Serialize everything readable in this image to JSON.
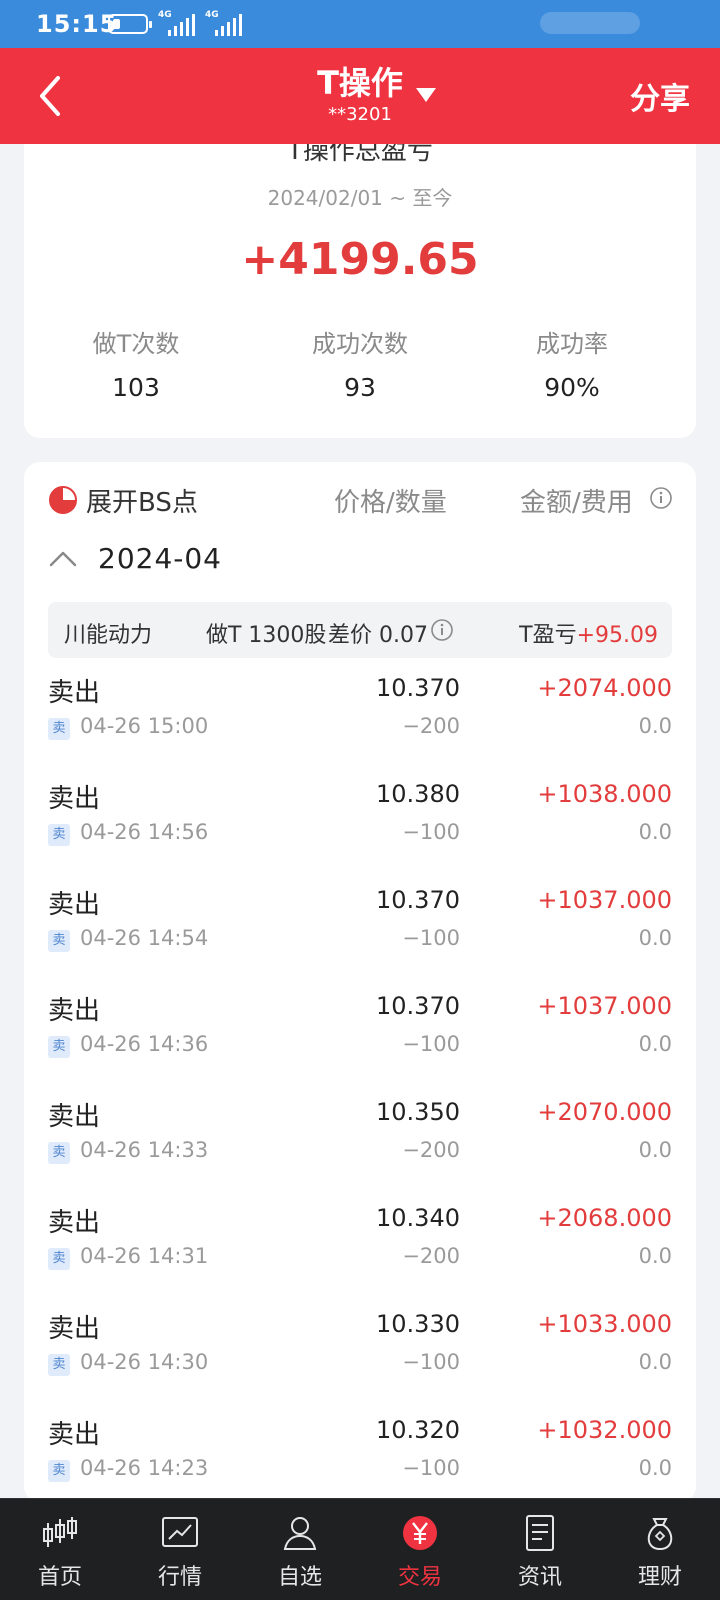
{
  "status_bar": {
    "time": "15:15",
    "network_1": "4G",
    "network_2": "4G"
  },
  "header": {
    "title": "T操作",
    "account": "**3201",
    "share_label": "分享",
    "color": "#ef3340"
  },
  "summary": {
    "title": "T操作总盈亏",
    "range": "2024/02/01 ~ 至今",
    "profit": "+4199.65",
    "stats": [
      {
        "label": "做T次数",
        "value": "103"
      },
      {
        "label": "成功次数",
        "value": "93"
      },
      {
        "label": "成功率",
        "value": "90%"
      }
    ]
  },
  "detail": {
    "toggle_label": "展开BS点",
    "col_price": "价格/数量",
    "col_amount": "金额/费用",
    "month": "2024-04",
    "stock": {
      "name": "川能动力",
      "do_t": "做T 1300股",
      "diff": "差价 0.07",
      "pl_label": "T盈亏",
      "pl_value": "+95.09"
    },
    "trades": [
      {
        "action": "卖出",
        "badge": "卖",
        "time": "04-26 15:00",
        "price": "10.370",
        "qty": "−200",
        "amount": "+2074.000",
        "fee": "0.0"
      },
      {
        "action": "卖出",
        "badge": "卖",
        "time": "04-26 14:56",
        "price": "10.380",
        "qty": "−100",
        "amount": "+1038.000",
        "fee": "0.0"
      },
      {
        "action": "卖出",
        "badge": "卖",
        "time": "04-26 14:54",
        "price": "10.370",
        "qty": "−100",
        "amount": "+1037.000",
        "fee": "0.0"
      },
      {
        "action": "卖出",
        "badge": "卖",
        "time": "04-26 14:36",
        "price": "10.370",
        "qty": "−100",
        "amount": "+1037.000",
        "fee": "0.0"
      },
      {
        "action": "卖出",
        "badge": "卖",
        "time": "04-26 14:33",
        "price": "10.350",
        "qty": "−200",
        "amount": "+2070.000",
        "fee": "0.0"
      },
      {
        "action": "卖出",
        "badge": "卖",
        "time": "04-26 14:31",
        "price": "10.340",
        "qty": "−200",
        "amount": "+2068.000",
        "fee": "0.0"
      },
      {
        "action": "卖出",
        "badge": "卖",
        "time": "04-26 14:30",
        "price": "10.330",
        "qty": "−100",
        "amount": "+1033.000",
        "fee": "0.0"
      },
      {
        "action": "卖出",
        "badge": "卖",
        "time": "04-26 14:23",
        "price": "10.320",
        "qty": "−100",
        "amount": "+1032.000",
        "fee": "0.0"
      }
    ]
  },
  "nav": [
    {
      "label": "首页",
      "icon": "candlestick-icon",
      "active": false
    },
    {
      "label": "行情",
      "icon": "chart-icon",
      "active": false
    },
    {
      "label": "自选",
      "icon": "user-icon",
      "active": false
    },
    {
      "label": "交易",
      "icon": "yen-icon",
      "active": true
    },
    {
      "label": "资讯",
      "icon": "document-icon",
      "active": false
    },
    {
      "label": "理财",
      "icon": "money-bag-icon",
      "active": false
    }
  ]
}
